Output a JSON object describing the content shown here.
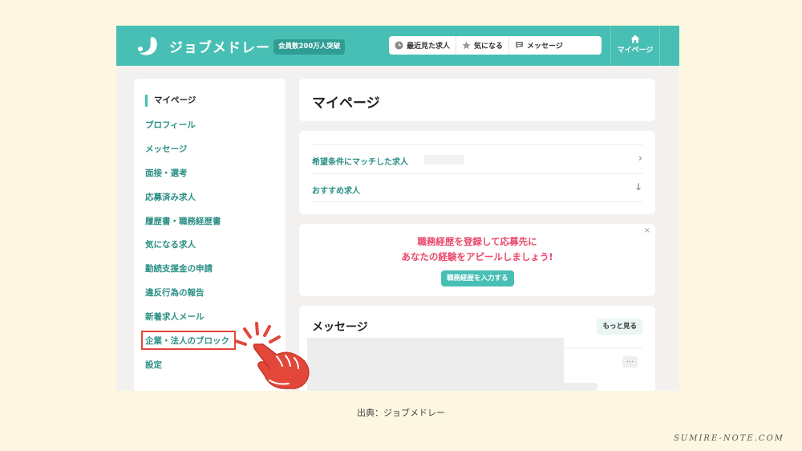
{
  "header": {
    "logo": "ジョブメドレー",
    "member_badge": "会員数200万人突破",
    "nav": [
      {
        "label": "最近見た求人",
        "icon": "clock-icon"
      },
      {
        "label": "気になる",
        "icon": "star-icon"
      },
      {
        "label": "メッセージ",
        "icon": "chat-icon"
      }
    ],
    "mypage": {
      "label": "マイページ",
      "icon": "home-icon"
    }
  },
  "sidebar": {
    "items": [
      {
        "label": "マイページ",
        "active": true
      },
      {
        "label": "プロフィール"
      },
      {
        "label": "メッセージ"
      },
      {
        "label": "面接・選考"
      },
      {
        "label": "応募済み求人"
      },
      {
        "label": "履歴書・職務経歴書"
      },
      {
        "label": "気になる求人"
      },
      {
        "label": "勤続支援金の申請"
      },
      {
        "label": "違反行為の報告"
      },
      {
        "label": "新着求人メール"
      },
      {
        "label": "企業・法人のブロック"
      },
      {
        "label": "設定"
      }
    ]
  },
  "main": {
    "title": "マイページ",
    "job_rows": [
      {
        "label": "希望条件にマッチした求人",
        "arrow": "›"
      },
      {
        "label": "おすすめ求人",
        "arrow": "↓"
      }
    ],
    "promo": {
      "line1": "職務経歴を登録して応募先に",
      "line2": "あなたの経験をアピールしましょう!",
      "button": "職務経歴を入力する",
      "close": "×"
    },
    "messages": {
      "title": "メッセージ",
      "more_button": "もっと見る",
      "menu": "…"
    }
  },
  "caption": "出典：ジョブメドレー",
  "watermark": "SUMIRE-NOTE.COM",
  "colors": {
    "background": "#fdf7e1",
    "brand": "#48bfb4",
    "link": "#2b8f86",
    "promo_text": "#e9496b",
    "annotation": "#e2473a"
  }
}
